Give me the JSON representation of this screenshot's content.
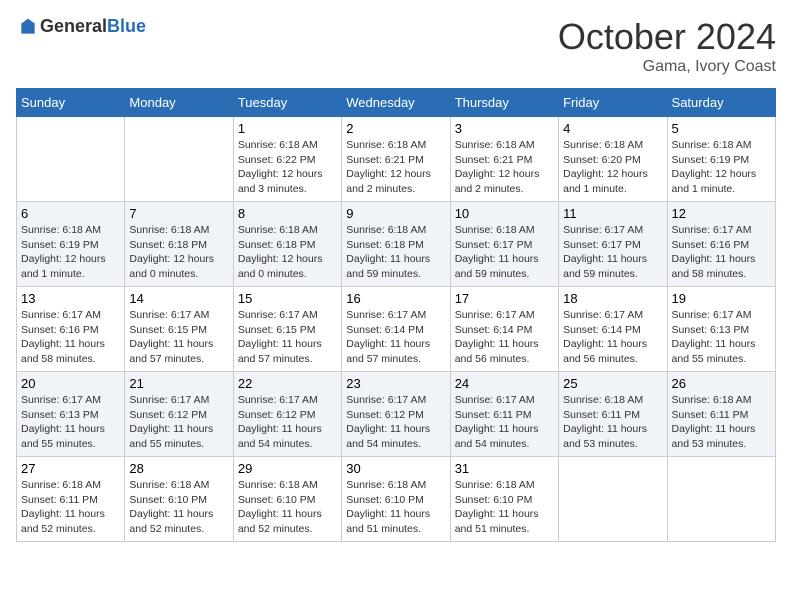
{
  "logo": {
    "text_general": "General",
    "text_blue": "Blue"
  },
  "title": {
    "month": "October 2024",
    "location": "Gama, Ivory Coast"
  },
  "days_of_week": [
    "Sunday",
    "Monday",
    "Tuesday",
    "Wednesday",
    "Thursday",
    "Friday",
    "Saturday"
  ],
  "weeks": [
    [
      {
        "day": "",
        "info": ""
      },
      {
        "day": "",
        "info": ""
      },
      {
        "day": "1",
        "info": "Sunrise: 6:18 AM\nSunset: 6:22 PM\nDaylight: 12 hours and 3 minutes."
      },
      {
        "day": "2",
        "info": "Sunrise: 6:18 AM\nSunset: 6:21 PM\nDaylight: 12 hours and 2 minutes."
      },
      {
        "day": "3",
        "info": "Sunrise: 6:18 AM\nSunset: 6:21 PM\nDaylight: 12 hours and 2 minutes."
      },
      {
        "day": "4",
        "info": "Sunrise: 6:18 AM\nSunset: 6:20 PM\nDaylight: 12 hours and 1 minute."
      },
      {
        "day": "5",
        "info": "Sunrise: 6:18 AM\nSunset: 6:19 PM\nDaylight: 12 hours and 1 minute."
      }
    ],
    [
      {
        "day": "6",
        "info": "Sunrise: 6:18 AM\nSunset: 6:19 PM\nDaylight: 12 hours and 1 minute."
      },
      {
        "day": "7",
        "info": "Sunrise: 6:18 AM\nSunset: 6:18 PM\nDaylight: 12 hours and 0 minutes."
      },
      {
        "day": "8",
        "info": "Sunrise: 6:18 AM\nSunset: 6:18 PM\nDaylight: 12 hours and 0 minutes."
      },
      {
        "day": "9",
        "info": "Sunrise: 6:18 AM\nSunset: 6:18 PM\nDaylight: 11 hours and 59 minutes."
      },
      {
        "day": "10",
        "info": "Sunrise: 6:18 AM\nSunset: 6:17 PM\nDaylight: 11 hours and 59 minutes."
      },
      {
        "day": "11",
        "info": "Sunrise: 6:17 AM\nSunset: 6:17 PM\nDaylight: 11 hours and 59 minutes."
      },
      {
        "day": "12",
        "info": "Sunrise: 6:17 AM\nSunset: 6:16 PM\nDaylight: 11 hours and 58 minutes."
      }
    ],
    [
      {
        "day": "13",
        "info": "Sunrise: 6:17 AM\nSunset: 6:16 PM\nDaylight: 11 hours and 58 minutes."
      },
      {
        "day": "14",
        "info": "Sunrise: 6:17 AM\nSunset: 6:15 PM\nDaylight: 11 hours and 57 minutes."
      },
      {
        "day": "15",
        "info": "Sunrise: 6:17 AM\nSunset: 6:15 PM\nDaylight: 11 hours and 57 minutes."
      },
      {
        "day": "16",
        "info": "Sunrise: 6:17 AM\nSunset: 6:14 PM\nDaylight: 11 hours and 57 minutes."
      },
      {
        "day": "17",
        "info": "Sunrise: 6:17 AM\nSunset: 6:14 PM\nDaylight: 11 hours and 56 minutes."
      },
      {
        "day": "18",
        "info": "Sunrise: 6:17 AM\nSunset: 6:14 PM\nDaylight: 11 hours and 56 minutes."
      },
      {
        "day": "19",
        "info": "Sunrise: 6:17 AM\nSunset: 6:13 PM\nDaylight: 11 hours and 55 minutes."
      }
    ],
    [
      {
        "day": "20",
        "info": "Sunrise: 6:17 AM\nSunset: 6:13 PM\nDaylight: 11 hours and 55 minutes."
      },
      {
        "day": "21",
        "info": "Sunrise: 6:17 AM\nSunset: 6:12 PM\nDaylight: 11 hours and 55 minutes."
      },
      {
        "day": "22",
        "info": "Sunrise: 6:17 AM\nSunset: 6:12 PM\nDaylight: 11 hours and 54 minutes."
      },
      {
        "day": "23",
        "info": "Sunrise: 6:17 AM\nSunset: 6:12 PM\nDaylight: 11 hours and 54 minutes."
      },
      {
        "day": "24",
        "info": "Sunrise: 6:17 AM\nSunset: 6:11 PM\nDaylight: 11 hours and 54 minutes."
      },
      {
        "day": "25",
        "info": "Sunrise: 6:18 AM\nSunset: 6:11 PM\nDaylight: 11 hours and 53 minutes."
      },
      {
        "day": "26",
        "info": "Sunrise: 6:18 AM\nSunset: 6:11 PM\nDaylight: 11 hours and 53 minutes."
      }
    ],
    [
      {
        "day": "27",
        "info": "Sunrise: 6:18 AM\nSunset: 6:11 PM\nDaylight: 11 hours and 52 minutes."
      },
      {
        "day": "28",
        "info": "Sunrise: 6:18 AM\nSunset: 6:10 PM\nDaylight: 11 hours and 52 minutes."
      },
      {
        "day": "29",
        "info": "Sunrise: 6:18 AM\nSunset: 6:10 PM\nDaylight: 11 hours and 52 minutes."
      },
      {
        "day": "30",
        "info": "Sunrise: 6:18 AM\nSunset: 6:10 PM\nDaylight: 11 hours and 51 minutes."
      },
      {
        "day": "31",
        "info": "Sunrise: 6:18 AM\nSunset: 6:10 PM\nDaylight: 11 hours and 51 minutes."
      },
      {
        "day": "",
        "info": ""
      },
      {
        "day": "",
        "info": ""
      }
    ]
  ]
}
